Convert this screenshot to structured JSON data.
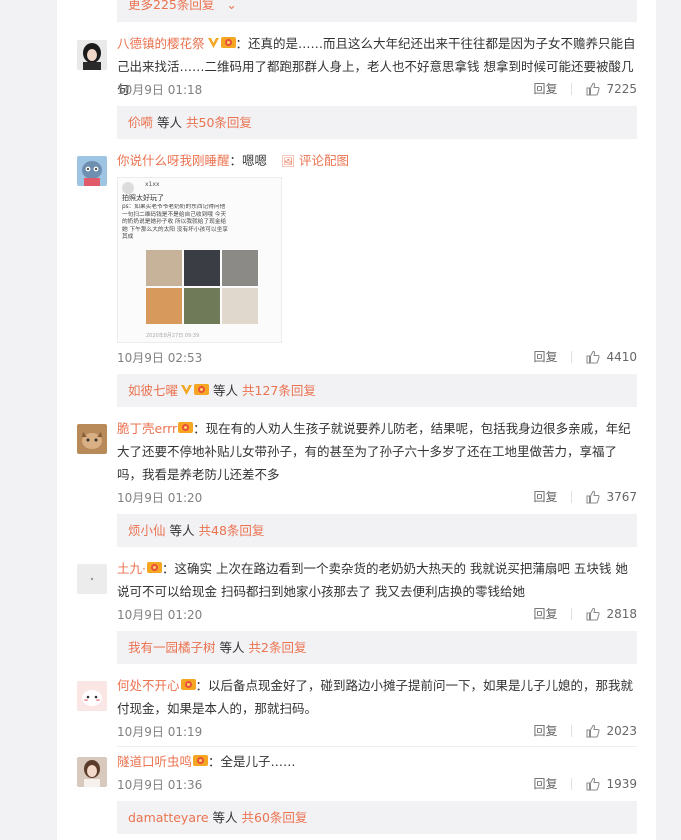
{
  "top_more": {
    "label": "更多225条回复"
  },
  "colors": {
    "accent": "#eb7350",
    "muted": "#808080",
    "panel_bg": "#f2f2f5"
  },
  "comments": [
    {
      "user": "八德镇的樱花祭",
      "text": "：还真的是……而且这么大年纪还出来干往往都是因为子女不赡养只能自己出来找活……二维码用了都跑那群人身上，老人也不好意思拿钱 想拿到时候可能还要被酸几句",
      "time": "10月9日 01:18",
      "reply": "回复",
      "likes": "7225",
      "sub": {
        "names": "伱嗬",
        "etc": "等人",
        "count": "共50条回复"
      }
    },
    {
      "user": "你说什么呀我刚睡醒",
      "text": "：嗯嗯",
      "img_note": "评论配图",
      "image_lines": [
        "x1xx",
        "拍照太好玩了",
        "ps：如果买老爷爷老奶奶的东西记得问他",
        "一句扫二维码钱是不是给自己收到哦 今天",
        "的奶奶说是她孙子收 所以我就给了现金给",
        "她 下午那么大的太阳 没有坏小孩可以坐享",
        "其成"
      ],
      "image_footer": "2020年8月27日 09:39",
      "time": "10月9日 02:53",
      "reply": "回复",
      "likes": "4410",
      "sub": {
        "names": "如彼七曜",
        "etc": "等人",
        "count": "共127条回复"
      }
    },
    {
      "user": "脆丁壳errr",
      "text": "：现在有的人劝人生孩子就说要养儿防老，结果呢，包括我身边很多亲戚，年纪大了还要不停地补贴儿女带孙子，有的甚至为了孙子六十多岁了还在工地里做苦力，享福了吗，我看是养老防儿还差不多",
      "time": "10月9日 01:20",
      "reply": "回复",
      "likes": "3767",
      "sub": {
        "names": "烦小仙",
        "etc": "等人",
        "count": "共48条回复"
      }
    },
    {
      "user": "土九·",
      "text": "：这确实 上次在路边看到一个卖杂货的老奶奶大热天的 我就说买把蒲扇吧 五块钱 她说可不可以给现金 扫码都扫到她家小孩那去了 我又去便利店换的零钱给她",
      "time": "10月9日 01:20",
      "reply": "回复",
      "likes": "2818",
      "sub": {
        "names": "我有一园橘子树",
        "etc": "等人",
        "count": "共2条回复"
      }
    },
    {
      "user": "何处不开心",
      "text": "：以后备点现金好了，碰到路边小摊子提前问一下，如果是儿子儿媳的，那我就付现金，如果是本人的，那就扫码。",
      "time": "10月9日 01:19",
      "reply": "回复",
      "likes": "2023"
    },
    {
      "user": "隧道口听虫鸣",
      "text": "：全是儿子……",
      "time": "10月9日 01:36",
      "reply": "回复",
      "likes": "1939",
      "sub": {
        "names": "damatteyare",
        "etc": "等人",
        "count": "共60条回复"
      }
    }
  ]
}
